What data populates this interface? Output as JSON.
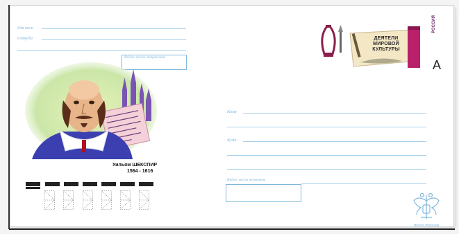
{
  "sender": {
    "from_label": "От кого",
    "from_where_label": "Откуда",
    "index_box_label": "Индекс места отправления"
  },
  "recipient": {
    "to_label": "Кому",
    "to_where_label": "Куда",
    "index_box_label": "Индекс места назначения"
  },
  "stamp": {
    "title_lines": [
      "ДЕЯТЕЛИ",
      "МИРОВОЙ",
      "КУЛЬТУРЫ"
    ],
    "country": "РОССИЯ",
    "rate_letter": "A"
  },
  "illustration": {
    "name": "Уильям ШЕКСПИР",
    "years": "1564 - 1616"
  },
  "footer": {
    "post_label": "ПОЧТА РОССИИ"
  },
  "colors": {
    "guideline_blue": "#a9d2ec",
    "label_blue": "#7fb7dc"
  }
}
